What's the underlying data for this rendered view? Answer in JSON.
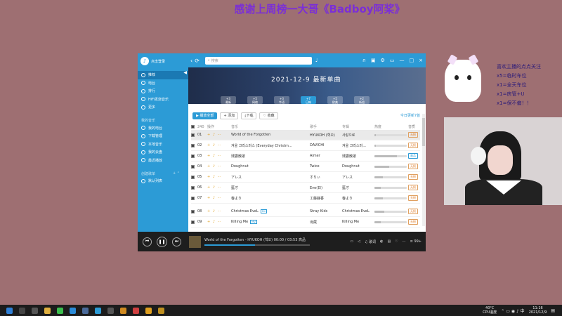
{
  "banner": {
    "text": "感谢上周榜一大哥《Badboy阿桨》"
  },
  "app": {
    "title": "点击登录",
    "search_placeholder": "搜索",
    "sidebar": {
      "items": [
        {
          "label": "推荐",
          "active": true
        },
        {
          "label": "电台"
        },
        {
          "label": "排行"
        },
        {
          "label": "HiFi发烧音乐"
        },
        {
          "label": "更多"
        }
      ],
      "my_music_header": "我的音乐",
      "my_items": [
        "我的电台",
        "下载管理",
        "本地音乐",
        "我的云盘",
        "最近播放"
      ],
      "playlist_header": "创建歌单",
      "playlist_items": [
        "默认列表"
      ]
    },
    "hero": {
      "title": "2021-12-9   最新单曲",
      "tabs": [
        {
          "count": "+3",
          "label": "最新"
        },
        {
          "count": "+5",
          "label": "网络"
        },
        {
          "count": "+3",
          "label": "华语"
        },
        {
          "count": "+7",
          "label": "日韩",
          "active": true
        },
        {
          "count": "+5",
          "label": "欧美"
        },
        {
          "count": "+2",
          "label": "新组"
        }
      ]
    },
    "controls": {
      "play_all": "▶ 播放全部",
      "add": "+ 添加",
      "download": "下载",
      "favorite": "♡ 收藏",
      "today": "今日更新7首"
    },
    "table": {
      "headers": {
        "count": "240",
        "ops": "操作",
        "title": "音乐",
        "artist": "歌手",
        "album": "专辑",
        "heat": "热度",
        "quality": "音质"
      },
      "rows": [
        {
          "no": "01",
          "title": "World of the Forgotten",
          "artist": "HYUKOH (혁오)",
          "album": "사랑으로",
          "heat": 0.05,
          "quality": "无损",
          "highlight": true
        },
        {
          "no": "02",
          "title": "겨울 크리스마스 (Everyday Christm...",
          "artist": "DAVICHI",
          "album": "겨울 크리스마...",
          "heat": 0.05,
          "quality": "无损"
        },
        {
          "no": "03",
          "title": "残響散歌",
          "artist": "Aimer",
          "album": "残響散歌",
          "heat": 0.7,
          "quality": "高品"
        },
        {
          "no": "04",
          "title": "Doughnut",
          "artist": "Twice",
          "album": "Doughnut",
          "heat": 0.45,
          "quality": "无损"
        },
        {
          "no": "05",
          "title": "アレス",
          "artist": "すりぃ",
          "album": "アレス",
          "heat": 0.25,
          "quality": "无损"
        },
        {
          "no": "06",
          "title": "藍才",
          "artist": "Eve(日)",
          "album": "藍才",
          "heat": 0.2,
          "quality": "无损"
        },
        {
          "no": "07",
          "title": "春より",
          "artist": "工藤静香",
          "album": "春より",
          "heat": 0.25,
          "quality": "无损"
        },
        {
          "no": "08",
          "title": "Christmas EveL",
          "artist": "Stray Kids",
          "album": "Christmas EveL",
          "heat": 0.3,
          "quality": "无损",
          "mv": "MV"
        },
        {
          "no": "09",
          "title": "Killing Me",
          "artist": "滝蔵",
          "album": "Killing Me",
          "heat": 0.2,
          "quality": "无损",
          "mv": "MV"
        }
      ]
    },
    "player": {
      "now_playing": "World of the Forgotten - HYUKOH (혁오)",
      "time": "00:00 / 03:53",
      "quality": "高品",
      "lyrics": "歌词",
      "count": "99+"
    }
  },
  "chat": {
    "lines": [
      "喜欢主播的点点关注",
      "x5=临时车位",
      "x1=全天车位",
      "x1=房管+U",
      "x1=保不偏！！"
    ]
  },
  "taskbar": {
    "temp": "40°C",
    "cpu": "CPU温度",
    "time": "11:16",
    "date": "2021/12/9"
  },
  "colors": {
    "accent": "#2c9bd6",
    "background": "#9e6f72",
    "player": "#1e1e1e"
  }
}
